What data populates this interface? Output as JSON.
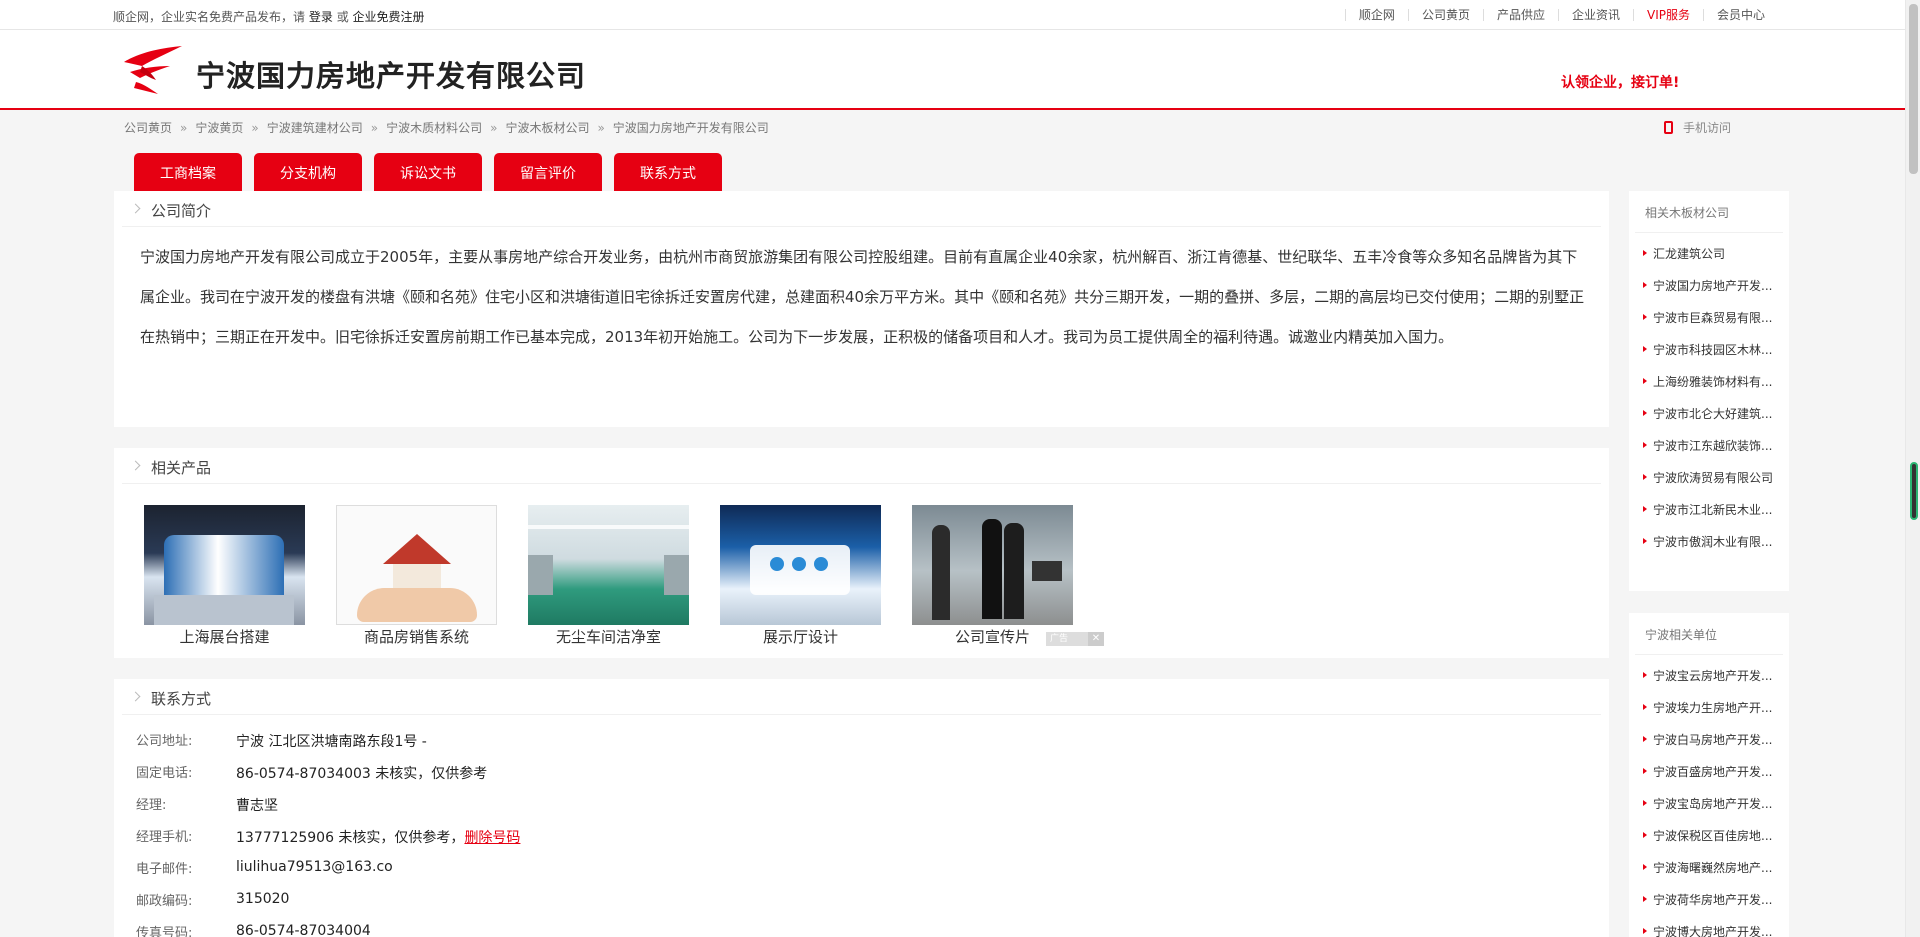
{
  "topbar": {
    "prompt_text": "顺企网，企业实名免费产品发布，请",
    "login": "登录",
    "or": "或",
    "register": "企业免费注册",
    "links": [
      "顺企网",
      "公司黄页",
      "产品供应",
      "企业资讯",
      "VIP服务",
      "会员中心"
    ]
  },
  "header": {
    "company_name": "宁波国力房地产开发有限公司",
    "claim": "认领企业，接订单!"
  },
  "breadcrumb": [
    "公司黄页",
    "宁波黄页",
    "宁波建筑建材公司",
    "宁波木质材料公司",
    "宁波木板材公司",
    "宁波国力房地产开发有限公司"
  ],
  "mobile_access": "手机访问",
  "tabs": [
    "工商档案",
    "分支机构",
    "诉讼文书",
    "留言评价",
    "联系方式"
  ],
  "intro": {
    "title": "公司简介",
    "text": "宁波国力房地产开发有限公司成立于2005年，主要从事房地产综合开发业务，由杭州市商贸旅游集团有限公司控股组建。目前有直属企业40余家，杭州解百、浙江肯德基、世纪联华、五丰冷食等众多知名品牌皆为其下属企业。我司在宁波开发的楼盘有洪塘《颐和名苑》住宅小区和洪塘街道旧宅徐拆迁安置房代建，总建面积40余万平方米。其中《颐和名苑》共分三期开发，一期的叠拼、多层，二期的高层均已交付使用；二期的别墅正在热销中；三期正在开发中。旧宅徐拆迁安置房前期工作已基本完成，2013年初开始施工。公司为下一步发展，正积极的储备项目和人才。我司为员工提供周全的福利待遇。诚邀业内精英加入国力。"
  },
  "products": {
    "title": "相关产品",
    "items": [
      {
        "caption": "上海展台搭建"
      },
      {
        "caption": "商品房销售系统"
      },
      {
        "caption": "无尘车间洁净室"
      },
      {
        "caption": "展示厅设计"
      },
      {
        "caption": "公司宣传片"
      }
    ],
    "ad_label": "广告"
  },
  "contact": {
    "title": "联系方式",
    "rows": [
      {
        "label": "公司地址:",
        "value": "宁波 江北区洪塘南路东段1号 -"
      },
      {
        "label": "固定电话:",
        "value": "86-0574-87034003 未核实，仅供参考"
      },
      {
        "label": "经理:",
        "value": "曹志坚"
      },
      {
        "label": "经理手机:",
        "value": "13777125906 未核实，仅供参考，",
        "link": "删除号码"
      },
      {
        "label": "电子邮件:",
        "value": "liulihua79513@163.co"
      },
      {
        "label": "邮政编码:",
        "value": "315020"
      },
      {
        "label": "传真号码:",
        "value": "86-0574-87034004"
      }
    ]
  },
  "sidebar": {
    "related_title": "相关木板材公司",
    "related": [
      "汇龙建筑公司",
      "宁波国力房地产开发...",
      "宁波市巨森贸易有限...",
      "宁波市科技园区木林...",
      "上海纷雅装饰材料有...",
      "宁波市北仑大好建筑...",
      "宁波市江东越欣装饰...",
      "宁波欣涛贸易有限公司",
      "宁波市江北新民木业...",
      "宁波市傲润木业有限..."
    ],
    "local_title": "宁波相关单位",
    "local": [
      "宁波宝云房地产开发...",
      "宁波埃力生房地产开...",
      "宁波白马房地产开发...",
      "宁波百盛房地产开发...",
      "宁波宝岛房地产开发...",
      "宁波保税区百佳房地...",
      "宁波海曙巍然房地产...",
      "宁波荷华房地产开发...",
      "宁波博大房地产开发..."
    ]
  }
}
